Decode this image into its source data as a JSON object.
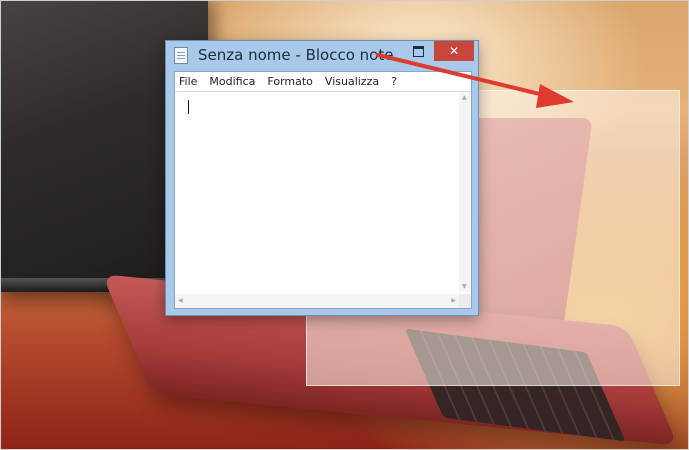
{
  "window": {
    "title": "Senza nome - Blocco note",
    "close_glyph": "✕",
    "menu": [
      "File",
      "Modifica",
      "Formato",
      "Visualizza",
      "?"
    ],
    "text": ""
  },
  "colors": {
    "titlebar": "#a9c9ea",
    "close_button": "#c9463d",
    "arrow": "#e03a2e"
  },
  "icons": {
    "app": "notepad-icon",
    "maximize": "maximize-icon",
    "close": "close-icon",
    "drag_indicator": "arrow-icon"
  }
}
